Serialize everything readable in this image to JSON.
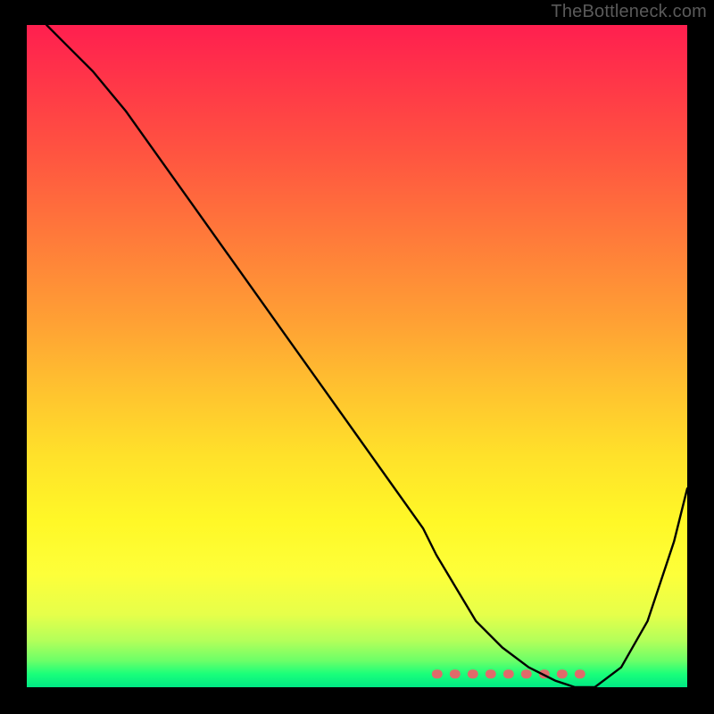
{
  "watermark": "TheBottleneck.com",
  "colors": {
    "frame": "#000000",
    "watermark_text": "#5a5a5a",
    "curve": "#000000",
    "marker": "#e06a6a"
  },
  "chart_data": {
    "type": "line",
    "title": "",
    "xlabel": "",
    "ylabel": "",
    "xlim": [
      0,
      100
    ],
    "ylim": [
      0,
      100
    ],
    "grid": false,
    "legend": false,
    "series": [
      {
        "name": "bottleneck-curve",
        "x": [
          3,
          6,
          10,
          15,
          20,
          25,
          30,
          35,
          40,
          45,
          50,
          55,
          60,
          62,
          65,
          68,
          72,
          76,
          80,
          83,
          86,
          90,
          94,
          98,
          100
        ],
        "y": [
          100,
          97,
          93,
          87,
          80,
          73,
          66,
          59,
          52,
          45,
          38,
          31,
          24,
          20,
          15,
          10,
          6,
          3,
          1,
          0,
          0,
          3,
          10,
          22,
          30
        ]
      }
    ],
    "annotations": [
      {
        "name": "optimal-zone-marker",
        "x_range": [
          62,
          85
        ],
        "y": 2,
        "color": "#e06a6a"
      }
    ],
    "background_gradient_stops": [
      {
        "pos": 0,
        "color": "#ff1f4f"
      },
      {
        "pos": 10,
        "color": "#ff3a47"
      },
      {
        "pos": 20,
        "color": "#ff5640"
      },
      {
        "pos": 32,
        "color": "#ff7a3a"
      },
      {
        "pos": 45,
        "color": "#ffa134"
      },
      {
        "pos": 55,
        "color": "#ffc22f"
      },
      {
        "pos": 65,
        "color": "#ffe12a"
      },
      {
        "pos": 75,
        "color": "#fff827"
      },
      {
        "pos": 83,
        "color": "#fdff3a"
      },
      {
        "pos": 89,
        "color": "#e6ff4a"
      },
      {
        "pos": 93,
        "color": "#b3ff5a"
      },
      {
        "pos": 96,
        "color": "#6cff68"
      },
      {
        "pos": 98,
        "color": "#1aff7a"
      },
      {
        "pos": 100,
        "color": "#00e884"
      }
    ]
  }
}
